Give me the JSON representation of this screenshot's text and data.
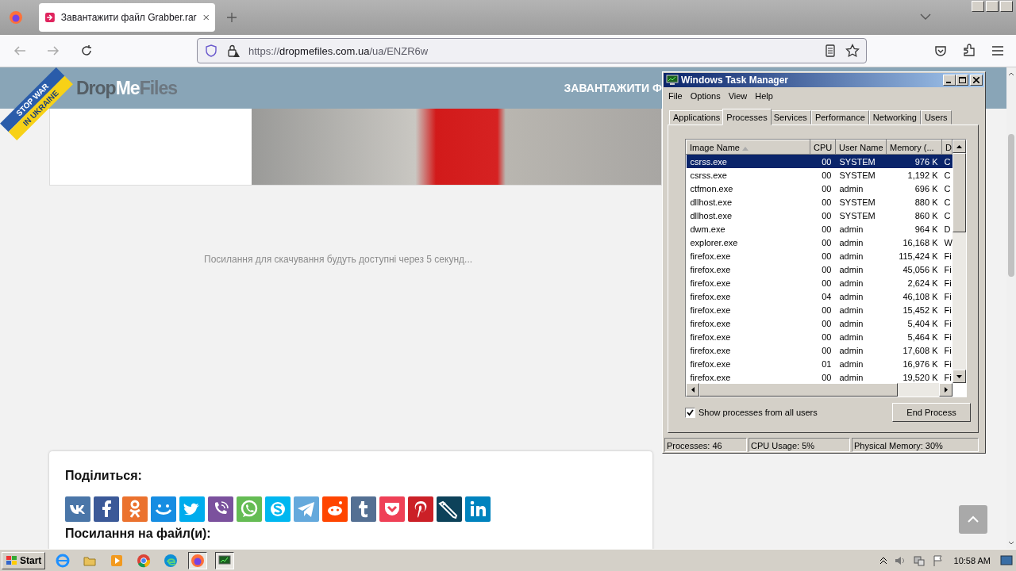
{
  "browser": {
    "tab": {
      "title": "Завантажити файл Grabber.rar",
      "selected": true
    },
    "address": {
      "scheme": "https://",
      "domain": "dropmefiles.com.ua",
      "path": "/ua/ENZR6w"
    }
  },
  "site": {
    "banner": [
      "STOP WAR",
      "IN UKRAINE"
    ],
    "logo": [
      "Drop",
      "Me",
      "Files"
    ],
    "nav_link": "ЗАВАНТАЖИТИ Ф",
    "wait_message": "Посилання для скачування будуть доступні через 5 секунд...",
    "share": {
      "heading": "Поділиться:",
      "buttons": [
        {
          "kind": "vk"
        },
        {
          "kind": "facebook"
        },
        {
          "kind": "ok"
        },
        {
          "kind": "moimir"
        },
        {
          "kind": "twitter"
        },
        {
          "kind": "viber"
        },
        {
          "kind": "whatsapp"
        },
        {
          "kind": "skype"
        },
        {
          "kind": "telegram"
        },
        {
          "kind": "reddit"
        },
        {
          "kind": "tumblr"
        },
        {
          "kind": "pocket"
        },
        {
          "kind": "pinterest"
        },
        {
          "kind": "livejournal"
        },
        {
          "kind": "linkedin"
        }
      ],
      "links_heading": "Посилання на файл(и):"
    }
  },
  "task_manager": {
    "title": "Windows Task Manager",
    "menu": [
      "File",
      "Options",
      "View",
      "Help"
    ],
    "tabs": [
      {
        "label": "Applications",
        "selected": false
      },
      {
        "label": "Processes",
        "selected": true
      },
      {
        "label": "Services",
        "selected": false
      },
      {
        "label": "Performance",
        "selected": false
      },
      {
        "label": "Networking",
        "selected": false
      },
      {
        "label": "Users",
        "selected": false
      }
    ],
    "table": {
      "columns": [
        "Image Name",
        "CPU",
        "User Name",
        "Memory (...",
        "D"
      ],
      "rows": [
        {
          "cells": [
            "csrss.exe",
            "00",
            "SYSTEM",
            "976 K",
            "C"
          ],
          "selected": true
        },
        {
          "cells": [
            "csrss.exe",
            "00",
            "SYSTEM",
            "1,192 K",
            "C"
          ],
          "selected": false
        },
        {
          "cells": [
            "ctfmon.exe",
            "00",
            "admin",
            "696 K",
            "C"
          ],
          "selected": false
        },
        {
          "cells": [
            "dllhost.exe",
            "00",
            "SYSTEM",
            "880 K",
            "C"
          ],
          "selected": false
        },
        {
          "cells": [
            "dllhost.exe",
            "00",
            "SYSTEM",
            "860 K",
            "C"
          ],
          "selected": false
        },
        {
          "cells": [
            "dwm.exe",
            "00",
            "admin",
            "964 K",
            "D"
          ],
          "selected": false
        },
        {
          "cells": [
            "explorer.exe",
            "00",
            "admin",
            "16,168 K",
            "W"
          ],
          "selected": false
        },
        {
          "cells": [
            "firefox.exe",
            "00",
            "admin",
            "115,424 K",
            "Fi"
          ],
          "selected": false
        },
        {
          "cells": [
            "firefox.exe",
            "00",
            "admin",
            "45,056 K",
            "Fi"
          ],
          "selected": false
        },
        {
          "cells": [
            "firefox.exe",
            "00",
            "admin",
            "2,624 K",
            "Fi"
          ],
          "selected": false
        },
        {
          "cells": [
            "firefox.exe",
            "04",
            "admin",
            "46,108 K",
            "Fi"
          ],
          "selected": false
        },
        {
          "cells": [
            "firefox.exe",
            "00",
            "admin",
            "15,452 K",
            "Fi"
          ],
          "selected": false
        },
        {
          "cells": [
            "firefox.exe",
            "00",
            "admin",
            "5,404 K",
            "Fi"
          ],
          "selected": false
        },
        {
          "cells": [
            "firefox.exe",
            "00",
            "admin",
            "5,464 K",
            "Fi"
          ],
          "selected": false
        },
        {
          "cells": [
            "firefox.exe",
            "00",
            "admin",
            "17,608 K",
            "Fi"
          ],
          "selected": false
        },
        {
          "cells": [
            "firefox.exe",
            "01",
            "admin",
            "16,976 K",
            "Fi"
          ],
          "selected": false
        },
        {
          "cells": [
            "firefox.exe",
            "00",
            "admin",
            "19,520 K",
            "Fi"
          ],
          "selected": false
        }
      ]
    },
    "show_all_users": {
      "label": "Show processes from all users",
      "checked": true
    },
    "end_button": "End Process",
    "status": [
      "Processes: 46",
      "CPU Usage: 5%",
      "Physical Memory: 30%"
    ]
  },
  "taskbar": {
    "start": "Start",
    "clock": "10:58 AM"
  }
}
